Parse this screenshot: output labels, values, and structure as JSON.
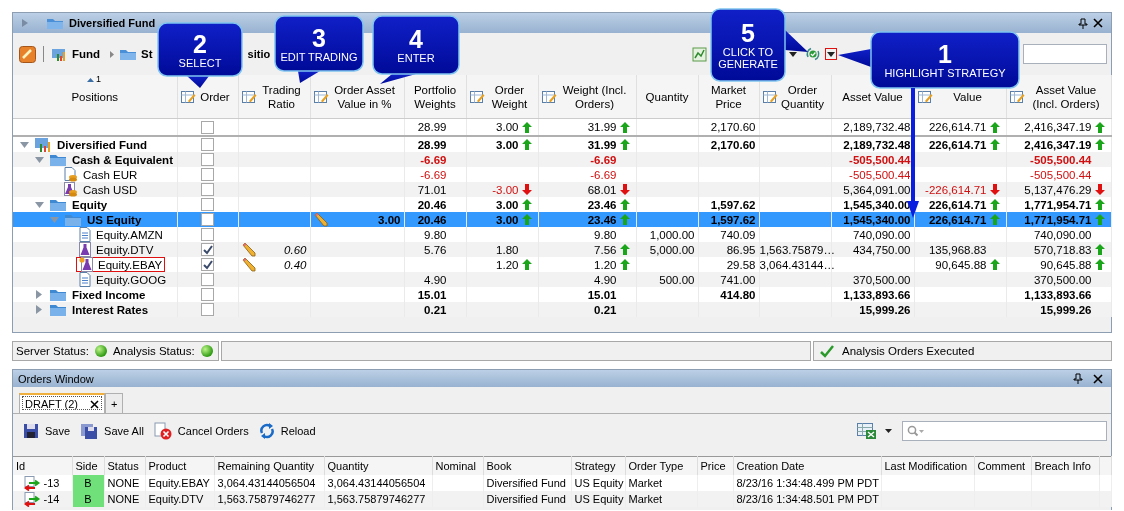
{
  "window": {
    "title": "Diversified Fund"
  },
  "toolbar": {
    "crumbs": [
      {
        "label": "Fund"
      },
      {
        "label": "St"
      }
    ],
    "fragment": "sitio",
    "strategy_picker": {
      "highlighted": true
    }
  },
  "positions": {
    "sort_indicator": "1",
    "columns": [
      {
        "label": "Positions",
        "editable": false
      },
      {
        "label": "Order",
        "editable": true
      },
      {
        "label": "Trading Ratio",
        "editable": true
      },
      {
        "label": "Order Asset Value in %",
        "editable": true
      },
      {
        "label": "Portfolio Weights",
        "editable": false
      },
      {
        "label": "Order Weight",
        "editable": true
      },
      {
        "label": "Weight (Incl. Orders)",
        "editable": true
      },
      {
        "label": "Quantity",
        "editable": false
      },
      {
        "label": "Market Price",
        "editable": false
      },
      {
        "label": "Order Quantity",
        "editable": true
      },
      {
        "label": "Asset Value",
        "editable": false
      },
      {
        "label": "Value",
        "editable": true
      },
      {
        "label": "Asset Value (Incl. Orders)",
        "editable": true
      }
    ],
    "total_row": {
      "checked": false,
      "cells": [
        null,
        null,
        {
          "text": "28.99"
        },
        {
          "text": "3.00",
          "kind": "up"
        },
        {
          "text": "31.99",
          "kind": "up"
        },
        null,
        {
          "text": "2,170.60"
        },
        null,
        {
          "text": "2,189,732.48"
        },
        {
          "text": "226,614.71",
          "kind": "up"
        },
        {
          "text": "2,416,347.19",
          "kind": "up"
        }
      ]
    },
    "tree": [
      {
        "label": "Diversified Fund",
        "kind": "fund",
        "bold": true,
        "expanded": true,
        "selected": false,
        "checked": false,
        "highlighted": false,
        "cells": [
          null,
          null,
          {
            "text": "28.99"
          },
          {
            "text": "3.00",
            "kind": "up"
          },
          {
            "text": "31.99",
            "kind": "up"
          },
          null,
          {
            "text": "2,170.60"
          },
          null,
          {
            "text": "2,189,732.48"
          },
          {
            "text": "226,614.71",
            "kind": "up"
          },
          {
            "text": "2,416,347.19",
            "kind": "up"
          }
        ],
        "children": [
          {
            "label": "Cash & Equivalent",
            "kind": "folder",
            "bold": true,
            "expanded": true,
            "selected": false,
            "checked": false,
            "highlighted": false,
            "cells": [
              null,
              null,
              {
                "text": "-6.69",
                "negative": true
              },
              null,
              {
                "text": "-6.69",
                "negative": true
              },
              null,
              null,
              null,
              {
                "text": "-505,500.44",
                "negative": true
              },
              null,
              {
                "text": "-505,500.44",
                "negative": true
              }
            ],
            "children": [
              {
                "label": "Cash EUR",
                "kind": "cash",
                "bold": false,
                "selected": false,
                "checked": false,
                "highlighted": false,
                "cells": [
                  null,
                  null,
                  {
                    "text": "-6.69",
                    "negative": true
                  },
                  null,
                  {
                    "text": "-6.69",
                    "negative": true
                  },
                  null,
                  null,
                  null,
                  {
                    "text": "-505,500.44",
                    "negative": true
                  },
                  null,
                  {
                    "text": "-505,500.44",
                    "negative": true
                  }
                ]
              },
              {
                "label": "Cash USD",
                "kind": "cash-flask",
                "bold": false,
                "selected": false,
                "checked": false,
                "highlighted": false,
                "cells": [
                  null,
                  null,
                  {
                    "text": "71.01"
                  },
                  {
                    "text": "-3.00",
                    "negative": true,
                    "kind": "down"
                  },
                  {
                    "text": "68.01",
                    "kind": "down"
                  },
                  null,
                  null,
                  null,
                  {
                    "text": "5,364,091.00"
                  },
                  {
                    "text": "-226,614.71",
                    "negative": true,
                    "kind": "down"
                  },
                  {
                    "text": "5,137,476.29",
                    "kind": "down"
                  }
                ]
              }
            ]
          },
          {
            "label": "Equity",
            "kind": "folder",
            "bold": true,
            "expanded": true,
            "selected": false,
            "checked": false,
            "highlighted": false,
            "cells": [
              null,
              null,
              {
                "text": "20.46"
              },
              {
                "text": "3.00",
                "kind": "up"
              },
              {
                "text": "23.46",
                "kind": "up"
              },
              null,
              {
                "text": "1,597.62"
              },
              null,
              {
                "text": "1,545,340.00"
              },
              {
                "text": "226,614.71",
                "kind": "up"
              },
              {
                "text": "1,771,954.71",
                "kind": "up"
              }
            ],
            "children": [
              {
                "label": "US Equity",
                "kind": "folder",
                "bold": true,
                "expanded": true,
                "selected": true,
                "checked": false,
                "highlighted": false,
                "cells": [
                  null,
                  {
                    "text": "3.00",
                    "pencil": true
                  },
                  {
                    "text": "20.46"
                  },
                  {
                    "text": "3.00",
                    "kind": "up"
                  },
                  {
                    "text": "23.46",
                    "kind": "up"
                  },
                  null,
                  {
                    "text": "1,597.62"
                  },
                  null,
                  {
                    "text": "1,545,340.00"
                  },
                  {
                    "text": "226,614.71",
                    "kind": "up"
                  },
                  {
                    "text": "1,771,954.71",
                    "kind": "up"
                  }
                ],
                "children": [
                  {
                    "label": "Equity.AMZN",
                    "kind": "document",
                    "bold": false,
                    "selected": false,
                    "checked": false,
                    "highlighted": false,
                    "cells": [
                      null,
                      null,
                      {
                        "text": "9.80"
                      },
                      null,
                      {
                        "text": "9.80"
                      },
                      {
                        "text": "1,000.00"
                      },
                      {
                        "text": "740.09"
                      },
                      null,
                      {
                        "text": "740,090.00"
                      },
                      null,
                      {
                        "text": "740,090.00"
                      }
                    ]
                  },
                  {
                    "label": "Equity.DTV",
                    "kind": "flask",
                    "bold": false,
                    "selected": false,
                    "checked": true,
                    "highlighted": false,
                    "cells": [
                      {
                        "text": "0.60",
                        "pencil": true
                      },
                      null,
                      {
                        "text": "5.76"
                      },
                      {
                        "text": "1.80"
                      },
                      {
                        "text": "7.56",
                        "kind": "up"
                      },
                      {
                        "text": "5,000.00"
                      },
                      {
                        "text": "86.95"
                      },
                      {
                        "text": "1,563.75879…"
                      },
                      {
                        "text": "434,750.00"
                      },
                      {
                        "text": "135,968.83"
                      },
                      {
                        "text": "570,718.83",
                        "kind": "up"
                      }
                    ]
                  },
                  {
                    "label": "Equity.EBAY",
                    "kind": "flask-new",
                    "bold": false,
                    "selected": false,
                    "checked": true,
                    "highlighted": true,
                    "cells": [
                      {
                        "text": "0.40",
                        "pencil": true
                      },
                      null,
                      null,
                      {
                        "text": "1.20",
                        "kind": "up"
                      },
                      {
                        "text": "1.20",
                        "kind": "up"
                      },
                      null,
                      {
                        "text": "29.58"
                      },
                      {
                        "text": "3,064.43144…"
                      },
                      null,
                      {
                        "text": "90,645.88",
                        "kind": "up"
                      },
                      {
                        "text": "90,645.88",
                        "kind": "up"
                      }
                    ]
                  },
                  {
                    "label": "Equity.GOOG",
                    "kind": "document",
                    "bold": false,
                    "selected": false,
                    "checked": false,
                    "highlighted": false,
                    "cells": [
                      null,
                      null,
                      {
                        "text": "4.90"
                      },
                      null,
                      {
                        "text": "4.90"
                      },
                      {
                        "text": "500.00"
                      },
                      {
                        "text": "741.00"
                      },
                      null,
                      {
                        "text": "370,500.00"
                      },
                      null,
                      {
                        "text": "370,500.00"
                      }
                    ]
                  }
                ]
              }
            ]
          },
          {
            "label": "Fixed Income",
            "kind": "folder",
            "bold": true,
            "expanded": false,
            "selected": false,
            "checked": false,
            "highlighted": false,
            "cells": [
              null,
              null,
              {
                "text": "15.01"
              },
              null,
              {
                "text": "15.01"
              },
              null,
              {
                "text": "414.80"
              },
              null,
              {
                "text": "1,133,893.66"
              },
              null,
              {
                "text": "1,133,893.66"
              }
            ]
          },
          {
            "label": "Interest Rates",
            "kind": "folder",
            "bold": true,
            "expanded": false,
            "selected": false,
            "checked": false,
            "highlighted": false,
            "cells": [
              null,
              null,
              {
                "text": "0.21"
              },
              null,
              {
                "text": "0.21"
              },
              null,
              null,
              null,
              {
                "text": "15,999.26"
              },
              null,
              {
                "text": "15,999.26"
              }
            ]
          }
        ]
      }
    ]
  },
  "callouts": [
    {
      "number": "2",
      "text": "SELECT"
    },
    {
      "number": "3",
      "text": "EDIT TRADING"
    },
    {
      "number": "4",
      "text": "ENTER"
    },
    {
      "number": "5",
      "text": "CLICK TO GENERATE"
    },
    {
      "number": "1",
      "text": "HIGHLIGHT STRATEGY"
    }
  ],
  "status_bar": {
    "server_label": "Server Status:",
    "server_ok": true,
    "analysis_label": "Analysis Status:",
    "analysis_ok": true,
    "message": "Analysis Orders Executed"
  },
  "orders_window": {
    "title": "Orders Window",
    "tabs": [
      {
        "label": "DRAFT (2)",
        "selected": true,
        "closable": true
      },
      {
        "label": "+",
        "selected": false,
        "closable": false
      }
    ],
    "actions": [
      {
        "kind": "save",
        "label": "Save"
      },
      {
        "kind": "save-all",
        "label": "Save All"
      },
      {
        "kind": "cancel",
        "label": "Cancel Orders"
      },
      {
        "kind": "reload",
        "label": "Reload"
      }
    ],
    "columns": [
      "Id",
      "Side",
      "Status",
      "Product",
      "Remaining Quantity",
      "Quantity",
      "Nominal",
      "Book",
      "Strategy",
      "Order Type",
      "Price",
      "Creation Date",
      "Last Modification",
      "Comment",
      "Breach Info"
    ],
    "rows": [
      {
        "id": "-13",
        "side": "B",
        "buy": true,
        "status": "NONE",
        "product": "Equity.EBAY",
        "remaining": "3,064.43144056504",
        "quantity": "3,064.43144056504",
        "book": "Diversified Fund",
        "strategy": "US Equity",
        "order_type": "Market",
        "created": "8/23/16 1:34:48.499 PM PDT"
      },
      {
        "id": "-14",
        "side": "B",
        "buy": true,
        "status": "NONE",
        "product": "Equity.DTV",
        "remaining": "1,563.75879746277",
        "quantity": "1,563.75879746277",
        "book": "Diversified Fund",
        "strategy": "US Equity",
        "order_type": "Market",
        "created": "8/23/16 1:34:48.501 PM PDT"
      }
    ]
  }
}
